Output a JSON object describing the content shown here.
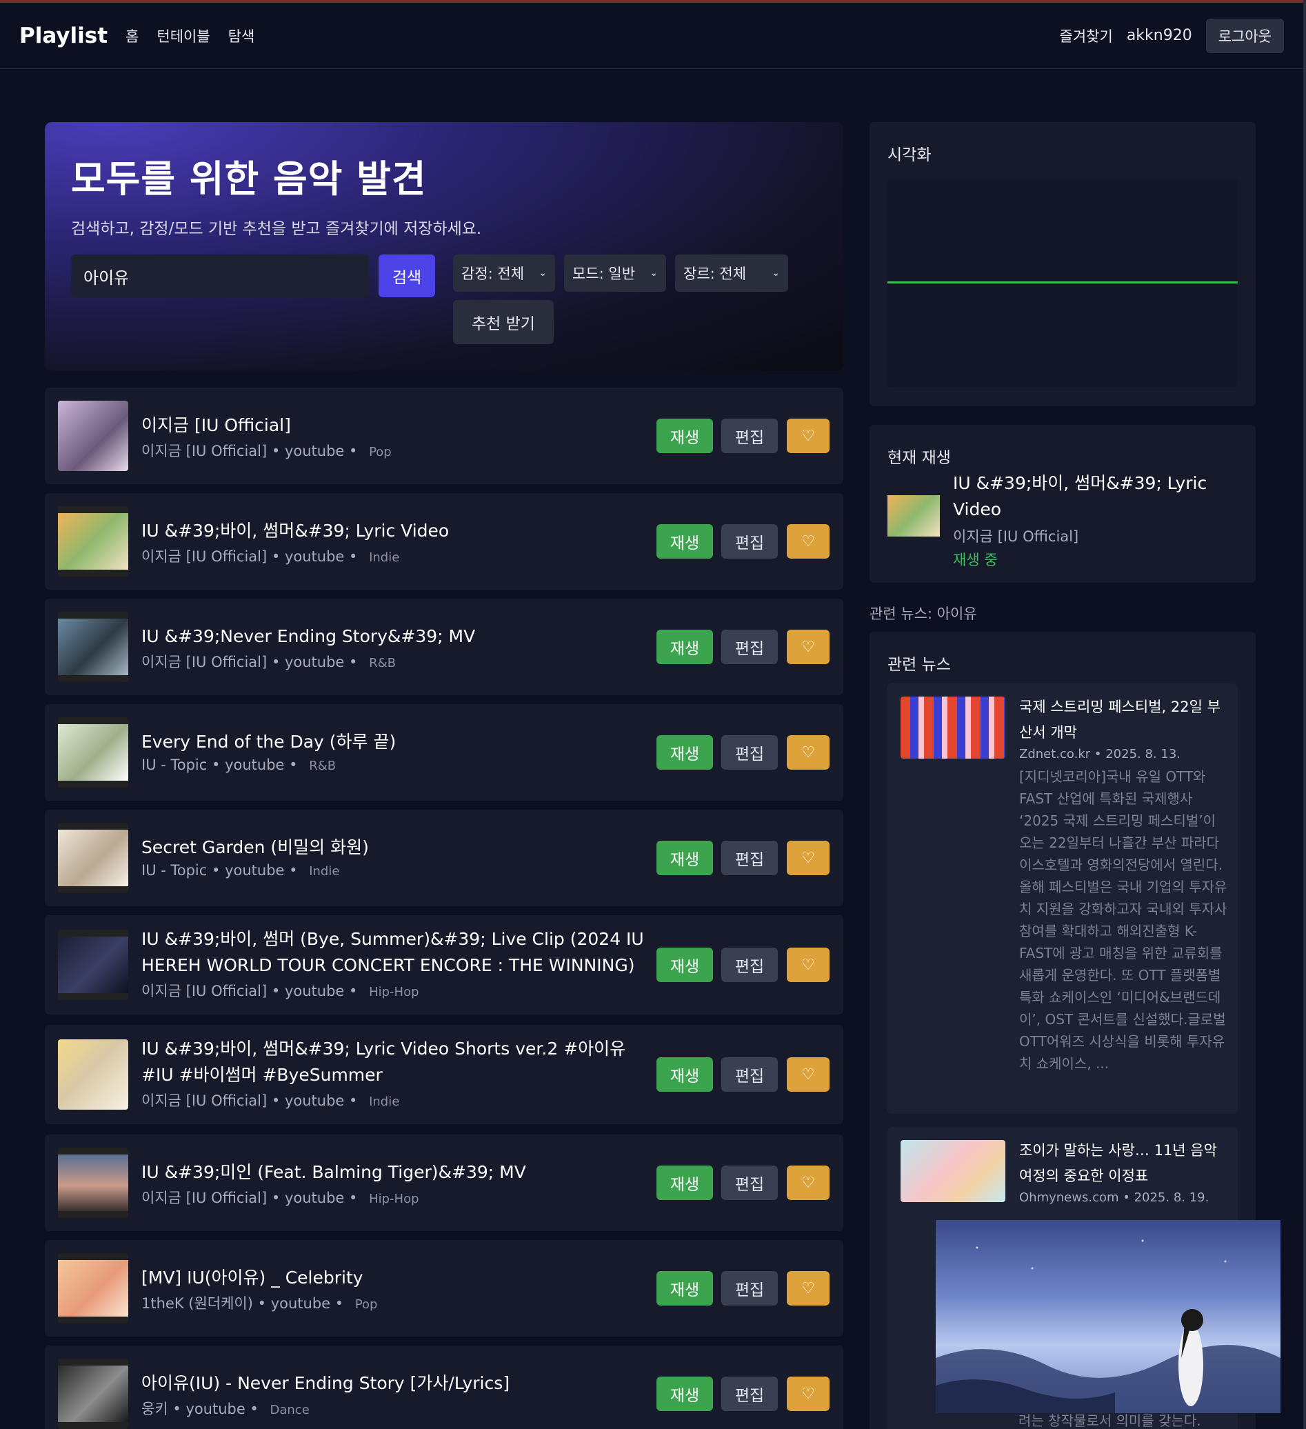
{
  "nav": {
    "brand": "Playlist",
    "links": [
      "홈",
      "턴테이블",
      "탐색"
    ],
    "favorites": "즐겨찾기",
    "username": "akkn920",
    "logout": "로그아웃"
  },
  "hero": {
    "title": "모두를 위한 음악 발견",
    "subtitle": "검색하고, 감정/모드 기반 추천을 받고 즐겨찾기에 저장하세요.",
    "search_value": "아이유",
    "search_button": "검색",
    "emotion_select": "감정: 전체",
    "mode_select": "모드: 일반",
    "genre_select": "장르: 전체",
    "recommend_button": "추천 받기"
  },
  "actions": {
    "play": "재생",
    "edit": "편집",
    "fav": "♡"
  },
  "tracks": [
    {
      "title": "이지금 [IU Official]",
      "artist": "이지금 [IU Official]",
      "source": "youtube",
      "genre": "Pop"
    },
    {
      "title": "IU &#39;바이, 썸머&#39; Lyric Video",
      "artist": "이지금 [IU Official]",
      "source": "youtube",
      "genre": "Indie"
    },
    {
      "title": "IU &#39;Never Ending Story&#39; MV",
      "artist": "이지금 [IU Official]",
      "source": "youtube",
      "genre": "R&B"
    },
    {
      "title": "Every End of the Day (하루 끝)",
      "artist": "IU - Topic",
      "source": "youtube",
      "genre": "R&B"
    },
    {
      "title": "Secret Garden (비밀의 화원)",
      "artist": "IU - Topic",
      "source": "youtube",
      "genre": "Indie"
    },
    {
      "title": "IU &#39;바이, 썸머 (Bye, Summer)&#39; Live Clip (2024 IU HEREH WORLD TOUR CONCERT ENCORE : THE WINNING)",
      "artist": "이지금 [IU Official]",
      "source": "youtube",
      "genre": "Hip-Hop"
    },
    {
      "title": "IU &#39;바이, 썸머&#39; Lyric Video Shorts ver.2 #아이유 #IU #바이썸머 #ByeSummer",
      "artist": "이지금 [IU Official]",
      "source": "youtube",
      "genre": "Indie"
    },
    {
      "title": "IU &#39;미인 (Feat. Balming Tiger)&#39; MV",
      "artist": "이지금 [IU Official]",
      "source": "youtube",
      "genre": "Hip-Hop"
    },
    {
      "title": "[MV] IU(아이유) _ Celebrity",
      "artist": "1theK (원더케이)",
      "source": "youtube",
      "genre": "Pop"
    },
    {
      "title": "아이유(IU) - Never Ending Story [가사/Lyrics]",
      "artist": "웅키",
      "source": "youtube",
      "genre": "Dance"
    }
  ],
  "viz": {
    "title": "시각화"
  },
  "now_playing": {
    "title": "현재 재생",
    "track": "IU &#39;바이, 썸머&#39; Lyric Video",
    "artist": "이지금 [IU Official]",
    "status": "재생 중"
  },
  "news": {
    "label": "관련 뉴스: 아이유",
    "title": "관련 뉴스",
    "items": [
      {
        "title": "국제 스트리밍 페스티벌, 22일 부산서 개막",
        "source": "Zdnet.co.kr • 2025. 8. 13.",
        "desc": "[지디넷코리아]국내 유일 OTT와 FAST 산업에 특화된 국제행사 ‘2025 국제 스트리밍 페스티벌’이 오는 22일부터 나흘간 부산 파라다이스호텔과 영화의전당에서 열린다.올해 페스티벌은 국내 기업의 투자유치 지원을 강화하고자 국내외 투자사 참여를 확대하고 해외진출형 K-FAST에 광고 매칭을 위한 교류회를 새롭게 운영한다. 또 OTT 플랫폼별 특화 쇼케이스인 ‘미디어&브랜드데이’, OST 콘서트를 신설했다.글로벌OTT어워즈 시상식을 비롯해 투자유치 쇼케이스, ..."
      },
      {
        "title": "조이가 말하는 사랑… 11년 음악 여정의 중요한 이정표",
        "source": "Ohmynews.com • 2025. 8. 19.",
        "desc": ""
      }
    ],
    "cut_text": "려는 창작물로서 의미를 갖는다."
  },
  "colors": {
    "background": "#0d1020",
    "card": "#161a2b",
    "accent": "#4b43e8",
    "play": "#3ca34f",
    "favorite": "#dda23a",
    "playing_status": "#3bbf5a"
  }
}
